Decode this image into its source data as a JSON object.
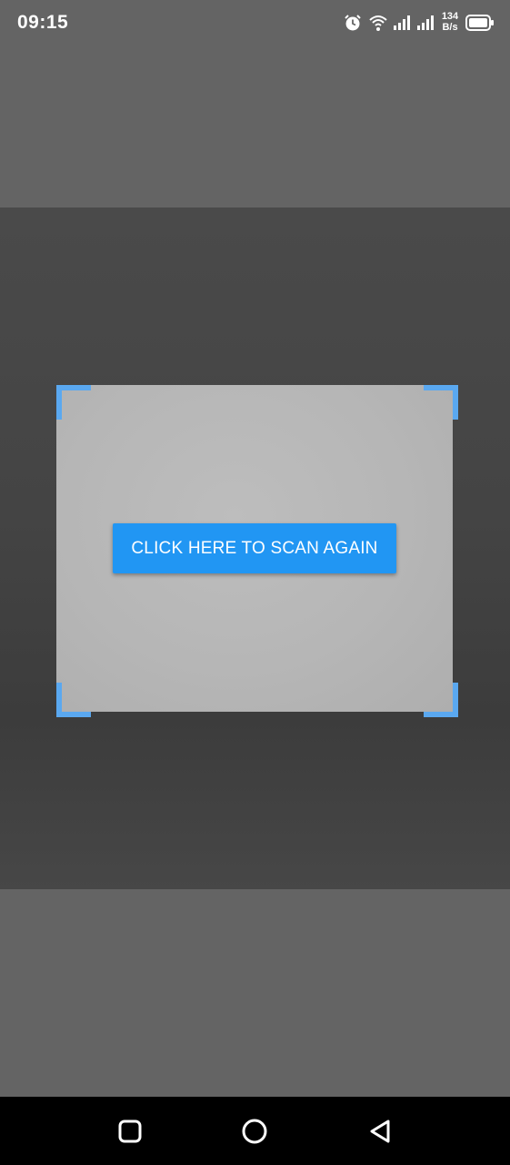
{
  "status_bar": {
    "time": "09:15",
    "net_speed_value": "134",
    "net_speed_unit": "B/s",
    "icons": [
      "alarm-icon",
      "wifi-icon",
      "signal-icon",
      "signal-icon",
      "battery-icon"
    ]
  },
  "scanner": {
    "button_label": "CLICK HERE TO SCAN AGAIN",
    "frame_color": "#5aa8f0",
    "button_color": "#2196f3"
  },
  "nav_bar": {
    "icons": [
      "recents-square-icon",
      "home-circle-icon",
      "back-triangle-icon"
    ]
  }
}
